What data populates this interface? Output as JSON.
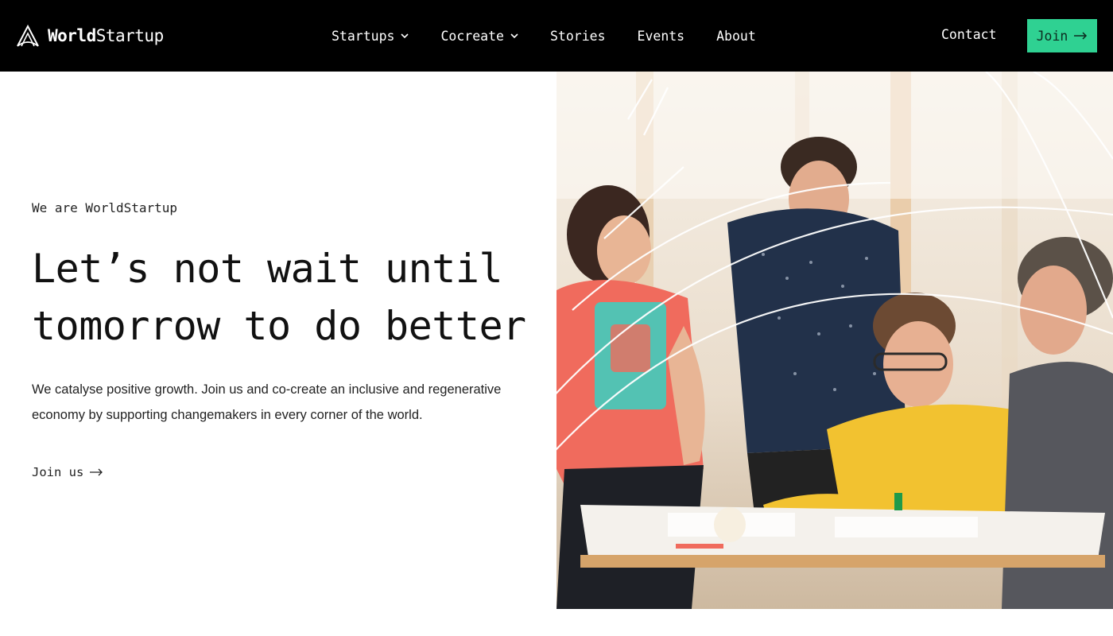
{
  "brand": {
    "name_bold": "World",
    "name_regular": "Startup",
    "logo_icon": "worldstartup-logo-icon"
  },
  "nav": {
    "items": [
      {
        "label": "Startups",
        "has_dropdown": true
      },
      {
        "label": "Cocreate",
        "has_dropdown": true
      },
      {
        "label": "Stories",
        "has_dropdown": false
      },
      {
        "label": "Events",
        "has_dropdown": false
      },
      {
        "label": "About",
        "has_dropdown": false
      }
    ],
    "contact_label": "Contact",
    "join_label": "Join"
  },
  "hero": {
    "eyebrow": "We are WorldStartup",
    "headline_line1": "Let’s not wait until",
    "headline_line2": "tomorrow to do better",
    "lede": "We catalyse positive growth. Join us and co-create an inclusive and regenerative economy by supporting changemakers in every corner of the world.",
    "cta_label": "Join us"
  },
  "colors": {
    "header_bg": "#000000",
    "accent_green": "#2fd192",
    "text": "#111111",
    "page_bg": "#ffffff"
  },
  "icons": {
    "dropdown": "chevron-down-icon",
    "arrow": "arrow-right-icon"
  }
}
